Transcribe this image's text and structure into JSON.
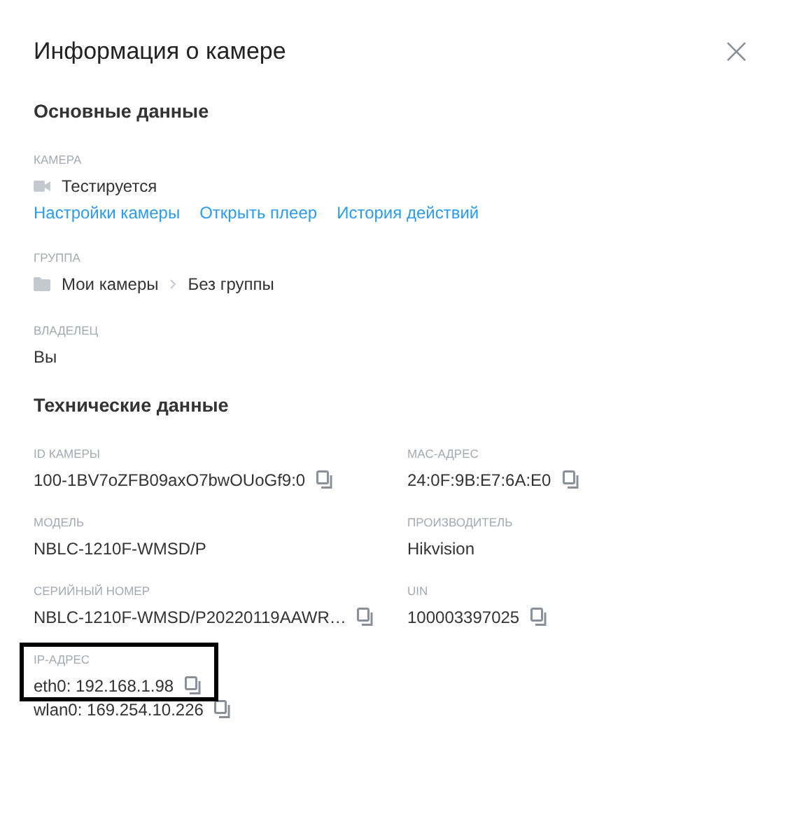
{
  "dialog": {
    "title": "Информация о камере",
    "close": "×"
  },
  "basic": {
    "heading": "Основные данные",
    "camera": {
      "label": "КАМЕРА",
      "name": "Тестируется",
      "links": [
        "Настройки камеры",
        "Открыть плеер",
        "История действий"
      ]
    },
    "group": {
      "label": "ГРУППА",
      "path": [
        "Мои камеры",
        "Без группы"
      ]
    },
    "owner": {
      "label": "ВЛАДЕЛЕЦ",
      "value": "Вы"
    }
  },
  "tech": {
    "heading": "Технические данные",
    "fields": [
      {
        "label": "ID КАМЕРЫ",
        "values": [
          {
            "text": "100-1BV7oZFB09axO7bwOUoGf9:0",
            "copyable": true
          }
        ],
        "highlighted": false
      },
      {
        "label": "MAC-АДРЕС",
        "values": [
          {
            "text": "24:0F:9B:E7:6A:E0",
            "copyable": true
          }
        ],
        "highlighted": false
      },
      {
        "label": "МОДЕЛЬ",
        "values": [
          {
            "text": "NBLC-1210F-WMSD/P",
            "copyable": false
          }
        ],
        "highlighted": false
      },
      {
        "label": "ПРОИЗВОДИТЕЛЬ",
        "values": [
          {
            "text": "Hikvision",
            "copyable": false
          }
        ],
        "highlighted": false
      },
      {
        "label": "СЕРИЙНЫЙ НОМЕР",
        "values": [
          {
            "text": "NBLC-1210F-WMSD/P20220119AAWR…",
            "copyable": true
          }
        ],
        "highlighted": false
      },
      {
        "label": "UIN",
        "values": [
          {
            "text": "100003397025",
            "copyable": true
          }
        ],
        "highlighted": false
      },
      {
        "label": "IP-АДРЕС",
        "values": [
          {
            "text": "eth0: 192.168.1.98",
            "copyable": true
          },
          {
            "text": "wlan0: 169.254.10.226",
            "copyable": true
          }
        ],
        "highlighted": true
      }
    ]
  }
}
